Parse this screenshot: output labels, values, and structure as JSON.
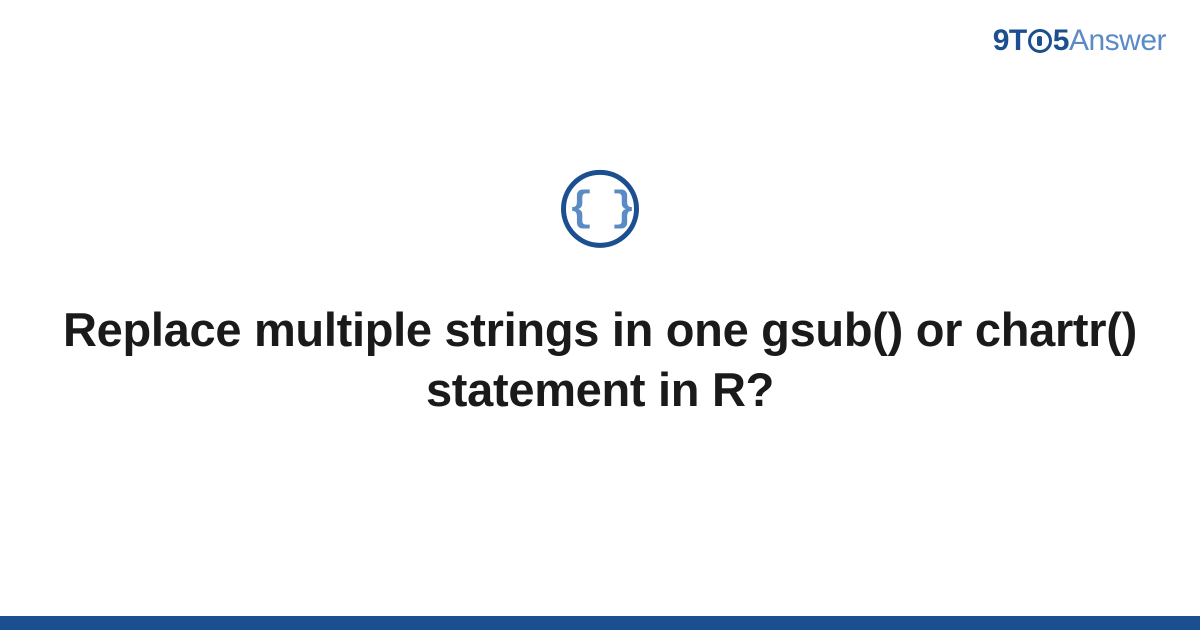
{
  "header": {
    "logo_part1": "9T",
    "logo_part2": "5",
    "logo_part3": "Answer"
  },
  "icon": {
    "content": "{ }"
  },
  "main": {
    "title": "Replace multiple strings in one gsub() or chartr() statement in R?"
  },
  "colors": {
    "primary": "#1c4f8f",
    "secondary": "#5a8bc4",
    "text": "#1a1a1a"
  }
}
